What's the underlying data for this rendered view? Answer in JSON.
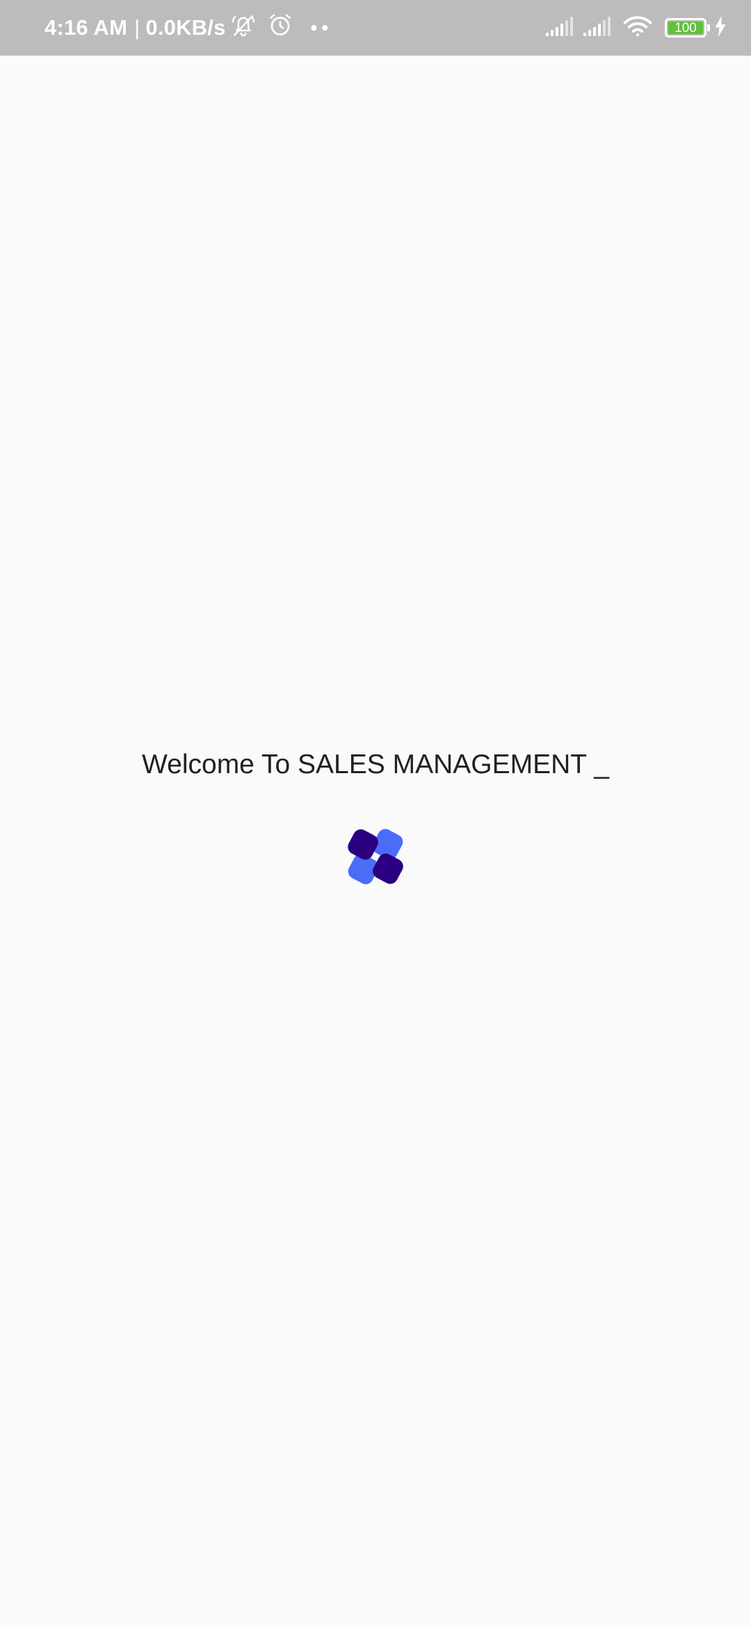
{
  "status_bar": {
    "time": "4:16 AM",
    "separator": "|",
    "net_speed": "0.0KB/s",
    "icons": [
      "mute-bell-icon",
      "alarm-icon",
      "more-dots-icon",
      "signal-icon",
      "signal-icon",
      "wifi-icon",
      "battery-icon",
      "charging-icon"
    ],
    "battery_level": "100",
    "battery_color": "#5ec23b",
    "background_color": "#bcbcbc"
  },
  "main": {
    "welcome_text": "Welcome To SALES MANAGEMENT _",
    "background_color": "#fafafa",
    "loader": {
      "icon": "loading-spinner-icon",
      "colors": [
        "#4a6cf7",
        "#2a0080"
      ]
    }
  }
}
